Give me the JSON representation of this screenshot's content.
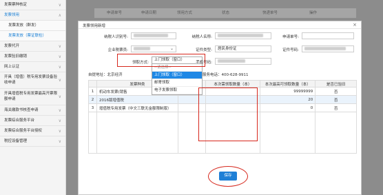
{
  "sidebar": {
    "items": [
      {
        "label": "发票票种核定",
        "arrow": "∨"
      },
      {
        "label": "发票领用",
        "arrow": "∧"
      },
      {
        "label": "发票发放（群发）"
      },
      {
        "label": "发票发放（票证联检）"
      },
      {
        "label": "发票代开",
        "arrow": "∨"
      },
      {
        "label": "发票验旧缴销",
        "arrow": "∨"
      },
      {
        "label": "网上认证",
        "arrow": "∨"
      },
      {
        "label": "开具（增值）税专用发票设备验收申请",
        "arrow": "∨"
      },
      {
        "label": "开具增值税专用发票最高开票限额申请",
        "arrow": "∨"
      },
      {
        "label": "海关缴款书核查申请",
        "arrow": "∨"
      },
      {
        "label": "发票综合服务平台",
        "arrow": "∨"
      },
      {
        "label": "发票综合服务平台授权",
        "arrow": "∨"
      },
      {
        "label": "税控设备管理",
        "arrow": "∨"
      }
    ]
  },
  "background": {
    "columns": [
      "申请单号",
      "申请日期",
      "领用方式",
      "状态",
      "快递单号",
      "操作"
    ]
  },
  "modal": {
    "title": "发票领用新增",
    "close": "×",
    "fields": {
      "taxpayer_id_label": "纳税人识别号:",
      "taxpayer_name_label": "纳税人名称:",
      "apply_no_label": "申请单号:",
      "enterprise_label": "企业税票员:",
      "id_type_label": "证件类型:",
      "id_type_value": "居民身份证",
      "id_no_label": "证件号码:",
      "pickup_label": "领取方式:",
      "phone_label": "手机号码:"
    },
    "pickup_select": {
      "value": "上门领取（窗口）",
      "chevron": "⌄"
    },
    "pickup_options": [
      "--请选择--",
      "上门领取（窗口）",
      "邮寄领取",
      "电子发票领取"
    ],
    "address_prefix": "自提地址：北京经济",
    "hotline": "服务电话：400-628-9911",
    "table": {
      "headers": [
        "",
        "发票种类",
        "",
        "本次需领取数量（本）",
        "本次最高可领取数量（本）",
        "是否已验旧"
      ],
      "rows": [
        {
          "no": "1",
          "type": "机动车发票(销售",
          "need": "",
          "max": "99999999",
          "verified": "否"
        },
        {
          "no": "2",
          "type": "2016版增值税",
          "need": "",
          "max": "20",
          "verified": "否"
        },
        {
          "no": "3",
          "type": "增值税专用发票（中文三联无金额限制版）",
          "need": "",
          "max": "0",
          "verified": "否"
        }
      ]
    },
    "save_label": "保存"
  },
  "colors": {
    "accent": "#1e7fd6",
    "annotation": "#d6261b",
    "selected": "#1e88e5"
  }
}
